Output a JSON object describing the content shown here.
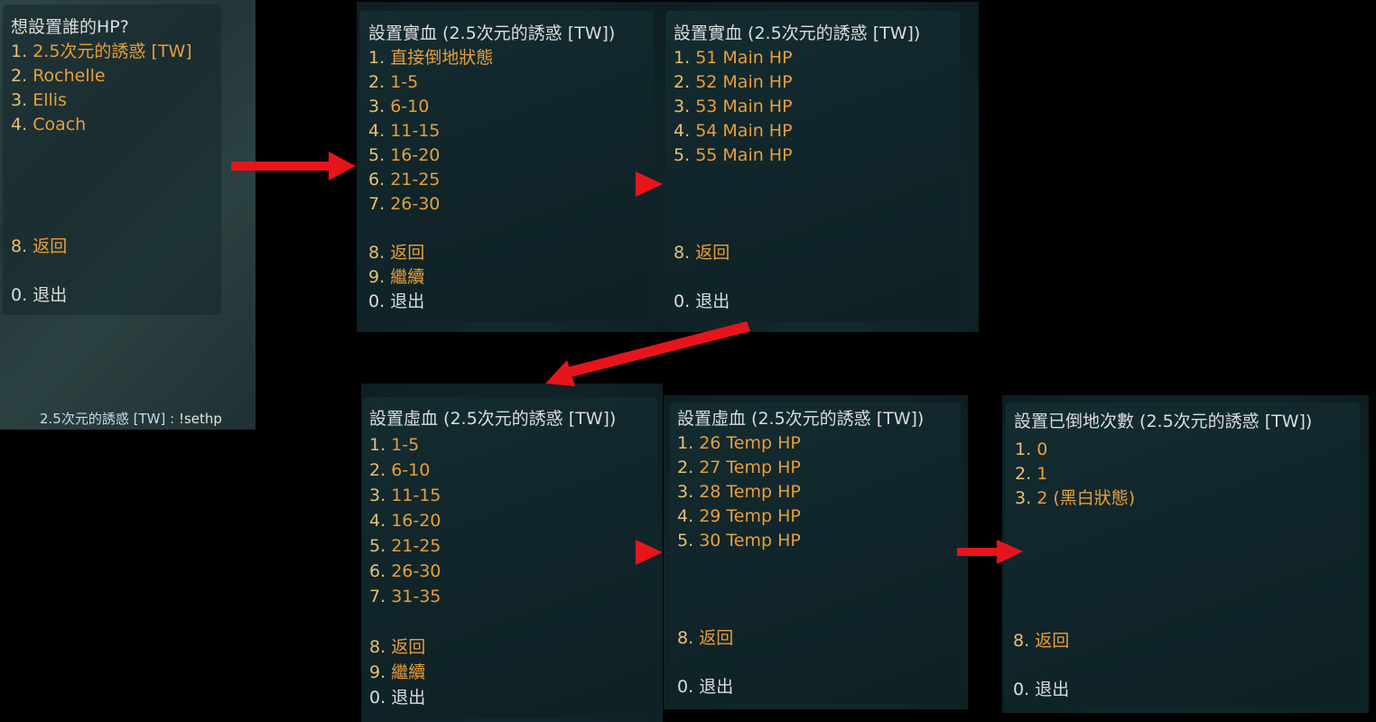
{
  "menu_select": {
    "title": "想設置誰的HP?",
    "items": [
      {
        "num": "1.",
        "label": "2.5次元的誘惑 [TW]"
      },
      {
        "num": "2.",
        "label": "Rochelle"
      },
      {
        "num": "3.",
        "label": "Ellis"
      },
      {
        "num": "4.",
        "label": "Coach"
      }
    ],
    "back": {
      "num": "8.",
      "label": "返回"
    },
    "exit": {
      "num": "0.",
      "label": "退出"
    }
  },
  "chat": {
    "name": "2.5次元的誘惑 [TW]",
    "sep": ":",
    "message": "!sethp"
  },
  "menu_real_1": {
    "title": "設置實血 (2.5次元的誘惑 [TW])",
    "items": [
      {
        "num": "1.",
        "label": "直接倒地狀態"
      },
      {
        "num": "2.",
        "label": "1-5"
      },
      {
        "num": "3.",
        "label": "6-10"
      },
      {
        "num": "4.",
        "label": "11-15"
      },
      {
        "num": "5.",
        "label": "16-20"
      },
      {
        "num": "6.",
        "label": "21-25"
      },
      {
        "num": "7.",
        "label": "26-30"
      }
    ],
    "back": {
      "num": "8.",
      "label": "返回"
    },
    "next": {
      "num": "9.",
      "label": "繼續"
    },
    "exit": {
      "num": "0.",
      "label": "退出"
    }
  },
  "menu_real_2": {
    "title": "設置實血 (2.5次元的誘惑 [TW])",
    "items": [
      {
        "num": "1.",
        "label": "51 Main HP"
      },
      {
        "num": "2.",
        "label": "52 Main HP"
      },
      {
        "num": "3.",
        "label": "53 Main HP"
      },
      {
        "num": "4.",
        "label": "54 Main HP"
      },
      {
        "num": "5.",
        "label": "55 Main HP"
      }
    ],
    "back": {
      "num": "8.",
      "label": "返回"
    },
    "exit": {
      "num": "0.",
      "label": "退出"
    }
  },
  "menu_temp_1": {
    "title": "設置虛血 (2.5次元的誘惑 [TW])",
    "items": [
      {
        "num": "1.",
        "label": "1-5"
      },
      {
        "num": "2.",
        "label": "6-10"
      },
      {
        "num": "3.",
        "label": "11-15"
      },
      {
        "num": "4.",
        "label": "16-20"
      },
      {
        "num": "5.",
        "label": "21-25"
      },
      {
        "num": "6.",
        "label": "26-30"
      },
      {
        "num": "7.",
        "label": "31-35"
      }
    ],
    "back": {
      "num": "8.",
      "label": "返回"
    },
    "next": {
      "num": "9.",
      "label": "繼續"
    },
    "exit": {
      "num": "0.",
      "label": "退出"
    }
  },
  "menu_temp_2": {
    "title": "設置虛血 (2.5次元的誘惑 [TW])",
    "items": [
      {
        "num": "1.",
        "label": "26 Temp HP"
      },
      {
        "num": "2.",
        "label": "27 Temp HP"
      },
      {
        "num": "3.",
        "label": "28 Temp HP"
      },
      {
        "num": "4.",
        "label": "29 Temp HP"
      },
      {
        "num": "5.",
        "label": "30 Temp HP"
      }
    ],
    "back": {
      "num": "8.",
      "label": "返回"
    },
    "exit": {
      "num": "0.",
      "label": "退出"
    }
  },
  "menu_incap": {
    "title": "設置已倒地次數 (2.5次元的誘惑 [TW])",
    "items": [
      {
        "num": "1.",
        "label": "0"
      },
      {
        "num": "2.",
        "label": "1"
      },
      {
        "num": "3.",
        "label": "2 (黑白狀態)"
      }
    ],
    "back": {
      "num": "8.",
      "label": "返回"
    },
    "exit": {
      "num": "0.",
      "label": "退出"
    }
  },
  "colors": {
    "arrow": "#e8141c",
    "option_text": "#e89e3a",
    "title_text": "#dcdcdc",
    "panel": "#0f2227"
  }
}
